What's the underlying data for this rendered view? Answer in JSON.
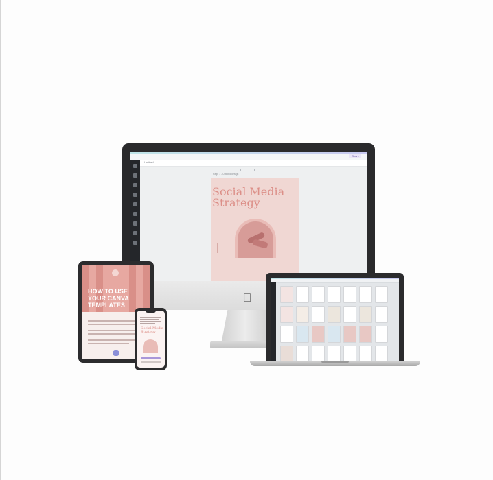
{
  "devices": {
    "desktop": {
      "toolbar_label": "Untitled",
      "page_label": "Page 1 - Untitled design",
      "share_button": "Share",
      "page": {
        "title": "Social Media\nStrategy"
      },
      "colors": {
        "page_bg": "#f0d7d3",
        "title": "#dc8f88"
      }
    },
    "tablet": {
      "title": "HOW TO USE\nYOUR CANVA\nTEMPLATES",
      "colors": {
        "hero_bg": "#e7a8a1",
        "title": "#ffffff"
      }
    },
    "phone": {
      "title": "Social Media\nStrategy"
    },
    "laptop": {
      "template_colors": [
        "#f3e4e2",
        "#ffffff",
        "#ffffff",
        "#ffffff",
        "#ffffff",
        "#ffffff",
        "#ffffff",
        "#f3e4e2",
        "#f4ede6",
        "#ffffff",
        "#ece6dd",
        "#ffffff",
        "#ece6dd",
        "#ffffff",
        "#ffffff",
        "#d9e7f0",
        "#e8c8c4",
        "#d9e7f0",
        "#e8c8c4",
        "#e8c8c4",
        "#ffffff",
        "#e9ddd7",
        "#ffffff",
        "#ffffff",
        "#ffffff",
        "#ffffff",
        "#ffffff",
        "#ffffff"
      ]
    }
  },
  "icons": {
    "apple": "apple-icon"
  }
}
